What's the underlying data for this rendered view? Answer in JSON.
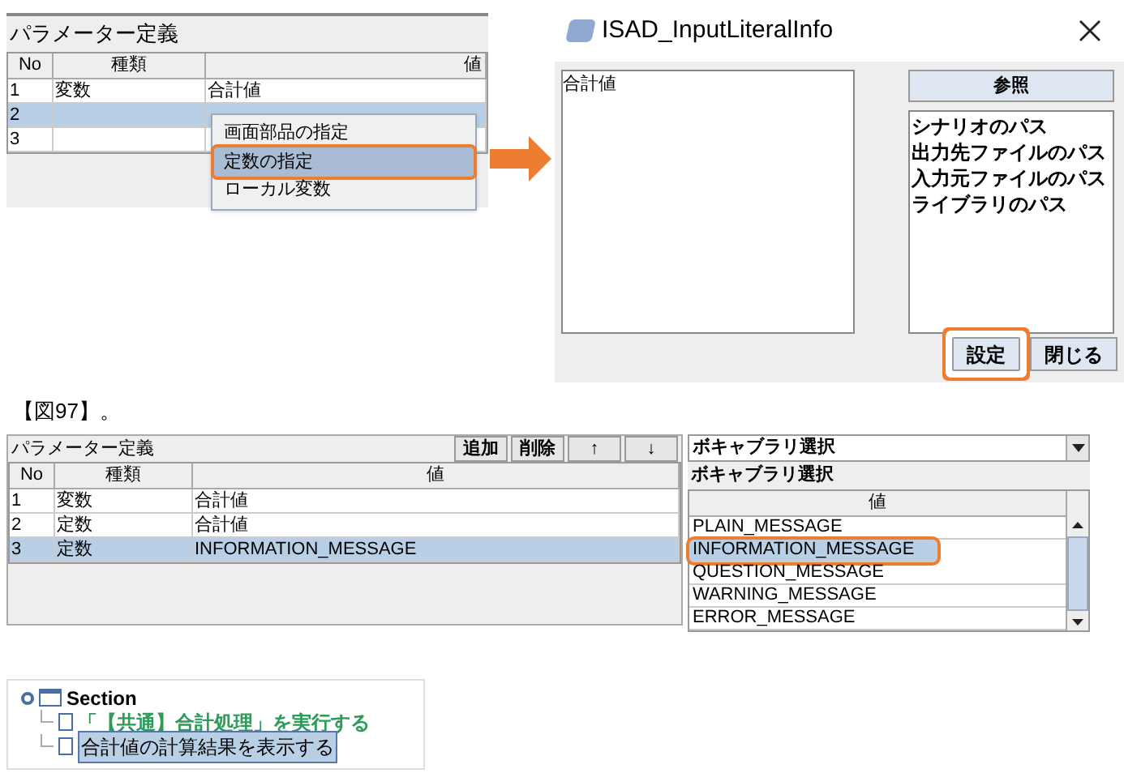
{
  "parameter_panel_before": {
    "title": "パラメーター定義",
    "columns": [
      "No",
      "種類",
      "値"
    ],
    "rows": [
      {
        "no": "1",
        "kind_text": "変数",
        "value": "合計値",
        "selected": false
      },
      {
        "no": "2",
        "kind_text": "",
        "value": "",
        "selected": true
      },
      {
        "no": "3",
        "kind_text": "",
        "value": "",
        "selected": false
      }
    ],
    "context_menu": [
      {
        "label": "画面部品の指定",
        "highlighted": false
      },
      {
        "label": "定数の指定",
        "highlighted": true
      },
      {
        "label": "ローカル変数",
        "highlighted": false
      }
    ]
  },
  "dialog": {
    "title": "ISAD_InputLiteralInfo",
    "text_value": "合計値",
    "browse_button": "参照",
    "path_list": [
      "シナリオのパス",
      "出力先ファイルのパス",
      "入力元ファイルのパス",
      "ライブラリのパス"
    ],
    "buttons": [
      {
        "label": "設定",
        "highlighted": true
      },
      {
        "label": "閉じる",
        "highlighted": false
      }
    ]
  },
  "caption": "【図97】。",
  "parameter_panel_after": {
    "title": "パラメーター定義",
    "buttons": [
      "追加",
      "削除",
      "↑",
      "↓"
    ],
    "columns": [
      "No",
      "種類",
      "値"
    ],
    "rows": [
      {
        "no": "1",
        "kind_text": "変数",
        "value": "合計値",
        "selected": false
      },
      {
        "no": "2",
        "kind_text": "定数",
        "value": "合計値",
        "selected": false
      },
      {
        "no": "3",
        "kind_text": "定数",
        "value": "INFORMATION_MESSAGE",
        "selected": true
      }
    ]
  },
  "vocabulary_panel": {
    "dropdown_value": "ボキャブラリ選択",
    "label": "ボキャブラリ選択",
    "column": "値",
    "items": [
      {
        "label": "PLAIN_MESSAGE",
        "selected": false,
        "highlighted": false
      },
      {
        "label": "INFORMATION_MESSAGE",
        "selected": true,
        "highlighted": true
      },
      {
        "label": "QUESTION_MESSAGE",
        "selected": false,
        "highlighted": false
      },
      {
        "label": "WARNING_MESSAGE",
        "selected": false,
        "highlighted": false
      },
      {
        "label": "ERROR_MESSAGE",
        "selected": false,
        "highlighted": false
      }
    ]
  },
  "tree": {
    "label": "Section",
    "children": [
      {
        "label": "「【共通】合計処理」を実行する",
        "selected": false,
        "color": "#2e9b5b"
      },
      {
        "label": "合計値の計算結果を表示する",
        "selected": true,
        "color": "#000000"
      }
    ]
  }
}
